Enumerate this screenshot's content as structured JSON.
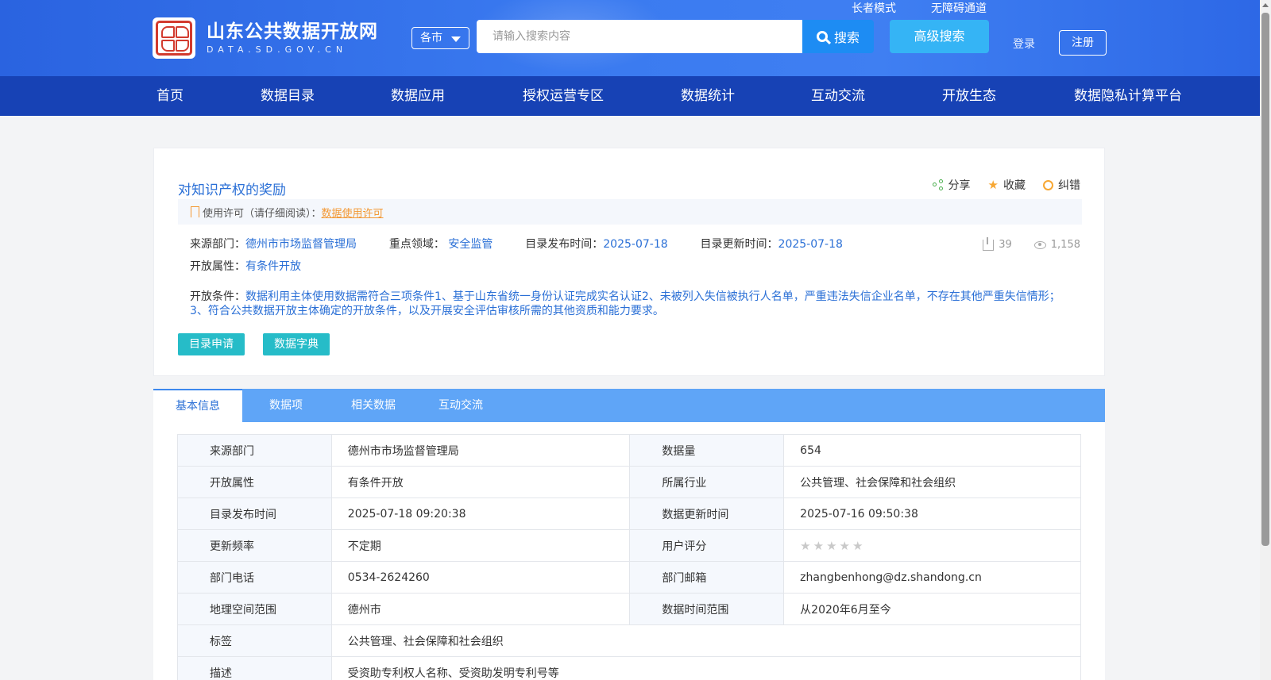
{
  "header": {
    "site_title": "山东公共数据开放网",
    "site_domain": "DATA.SD.GOV.CN",
    "elder_mode": "长者模式",
    "accessibility": "无障碍通道",
    "city_select": "各市",
    "search_placeholder": "请输入搜索内容",
    "search_label": "搜索",
    "advanced_search": "高级搜索",
    "login": "登录",
    "register": "注册"
  },
  "nav": [
    "首页",
    "数据目录",
    "数据应用",
    "授权运营专区",
    "数据统计",
    "互动交流",
    "开放生态",
    "数据隐私计算平台"
  ],
  "detail": {
    "title": "对知识产权的奖励",
    "share": "分享",
    "favorite": "收藏",
    "report_error": "纠错",
    "license_label": "使用许可（请仔细阅读）：",
    "license_link": "数据使用许可",
    "source_label": "来源部门：",
    "source_value": "德州市市场监督管理局",
    "domain_label": "重点领域：",
    "domain_value": "安全监管",
    "publish_label": "目录发布时间：",
    "publish_value": "2025-07-18",
    "update_label": "目录更新时间：",
    "update_value": "2025-07-18",
    "downloads": "39",
    "views": "1,158",
    "open_attr_label": "开放属性：",
    "open_attr_value": "有条件开放",
    "condition_label": "开放条件：",
    "condition_value": "数据利用主体使用数据需符合三项条件1、基于山东省统一身份认证完成实名认证2、未被列入失信被执行人名单，严重违法失信企业名单，不存在其他严重失信情形；3、符合公共数据开放主体确定的开放条件，以及开展安全评估审核所需的其他资质和能力要求。",
    "btn_apply": "目录申请",
    "btn_dictionary": "数据字典"
  },
  "tabs": [
    "基本信息",
    "数据项",
    "相关数据",
    "互动交流"
  ],
  "info_table": {
    "r1": {
      "l1": "来源部门",
      "v1": "德州市市场监督管理局",
      "l2": "数据量",
      "v2": "654"
    },
    "r2": {
      "l1": "开放属性",
      "v1": "有条件开放",
      "l2": "所属行业",
      "v2": "公共管理、社会保障和社会组织"
    },
    "r3": {
      "l1": "目录发布时间",
      "v1": "2025-07-18 09:20:38",
      "l2": "数据更新时间",
      "v2": "2025-07-16 09:50:38"
    },
    "r4": {
      "l1": "更新频率",
      "v1": "不定期",
      "l2": "用户评分",
      "rating": 0,
      "rating_max": 5
    },
    "r5": {
      "l1": "部门电话",
      "v1": "0534-2624260",
      "l2": "部门邮箱",
      "v2": "zhangbenhong@dz.shandong.cn"
    },
    "r6": {
      "l1": "地理空间范围",
      "v1": "德州市",
      "l2": "数据时间范围",
      "v2": "从2020年6月至今"
    },
    "r7": {
      "l1": "标签",
      "v1": "公共管理、社会保障和社会组织"
    },
    "r8": {
      "l1": "描述",
      "v1": "受资助专利权人名称、受资助发明专利号等"
    }
  },
  "colors": {
    "header_blue": "#3a7af0",
    "nav_blue": "#1742b5",
    "link_blue": "#2a6fd6",
    "teal_button": "#26bcc8",
    "accent_orange": "#f39833"
  }
}
